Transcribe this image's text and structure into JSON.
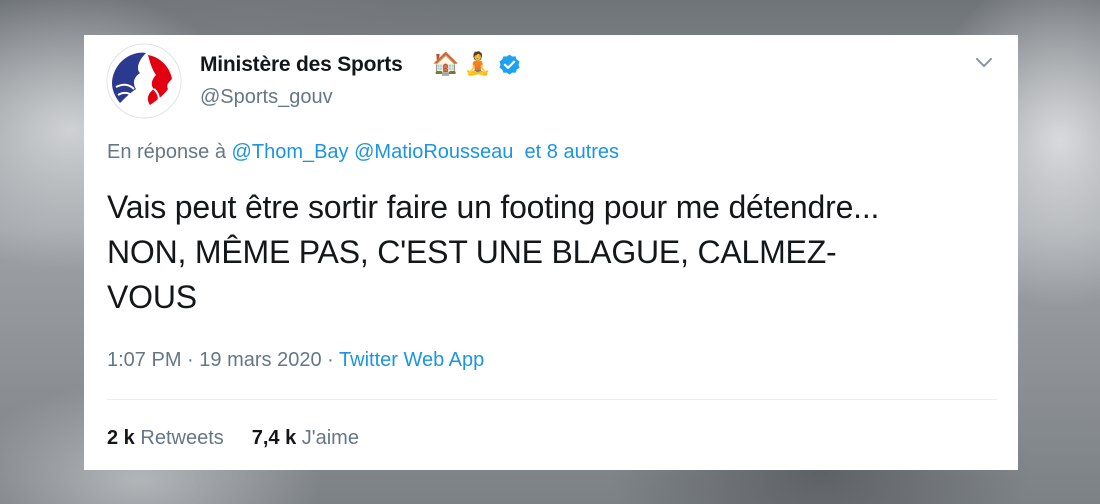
{
  "tweet": {
    "author": {
      "display_name": "Ministère des Sports",
      "name_emojis": [
        "🏠",
        "🧘"
      ],
      "handle": "@Sports_gouv",
      "verified": true,
      "avatar_icon": "marianne-logo-icon"
    },
    "reply_to": {
      "prefix": "En réponse à",
      "mentions": [
        "@Thom_Bay",
        "@MatioRousseau"
      ],
      "others": "et 8 autres"
    },
    "text_lines": [
      "Vais peut être sortir faire un footing pour me détendre...",
      "NON, MÊME PAS, C'EST UNE BLAGUE, CALMEZ-",
      "VOUS"
    ],
    "time": "1:07 PM",
    "separator": "·",
    "date": "19 mars 2020",
    "source": "Twitter Web App",
    "stats": {
      "retweets_count": "2 k",
      "retweets_label": "Retweets",
      "likes_count": "7,4 k",
      "likes_label": "J'aime"
    }
  },
  "colors": {
    "text": "#14171a",
    "secondary": "#657786",
    "link": "#1b95e0",
    "verified_badge": "#1da1f2",
    "marianne_blue": "#2b3a8f",
    "marianne_red": "#e1000f"
  }
}
